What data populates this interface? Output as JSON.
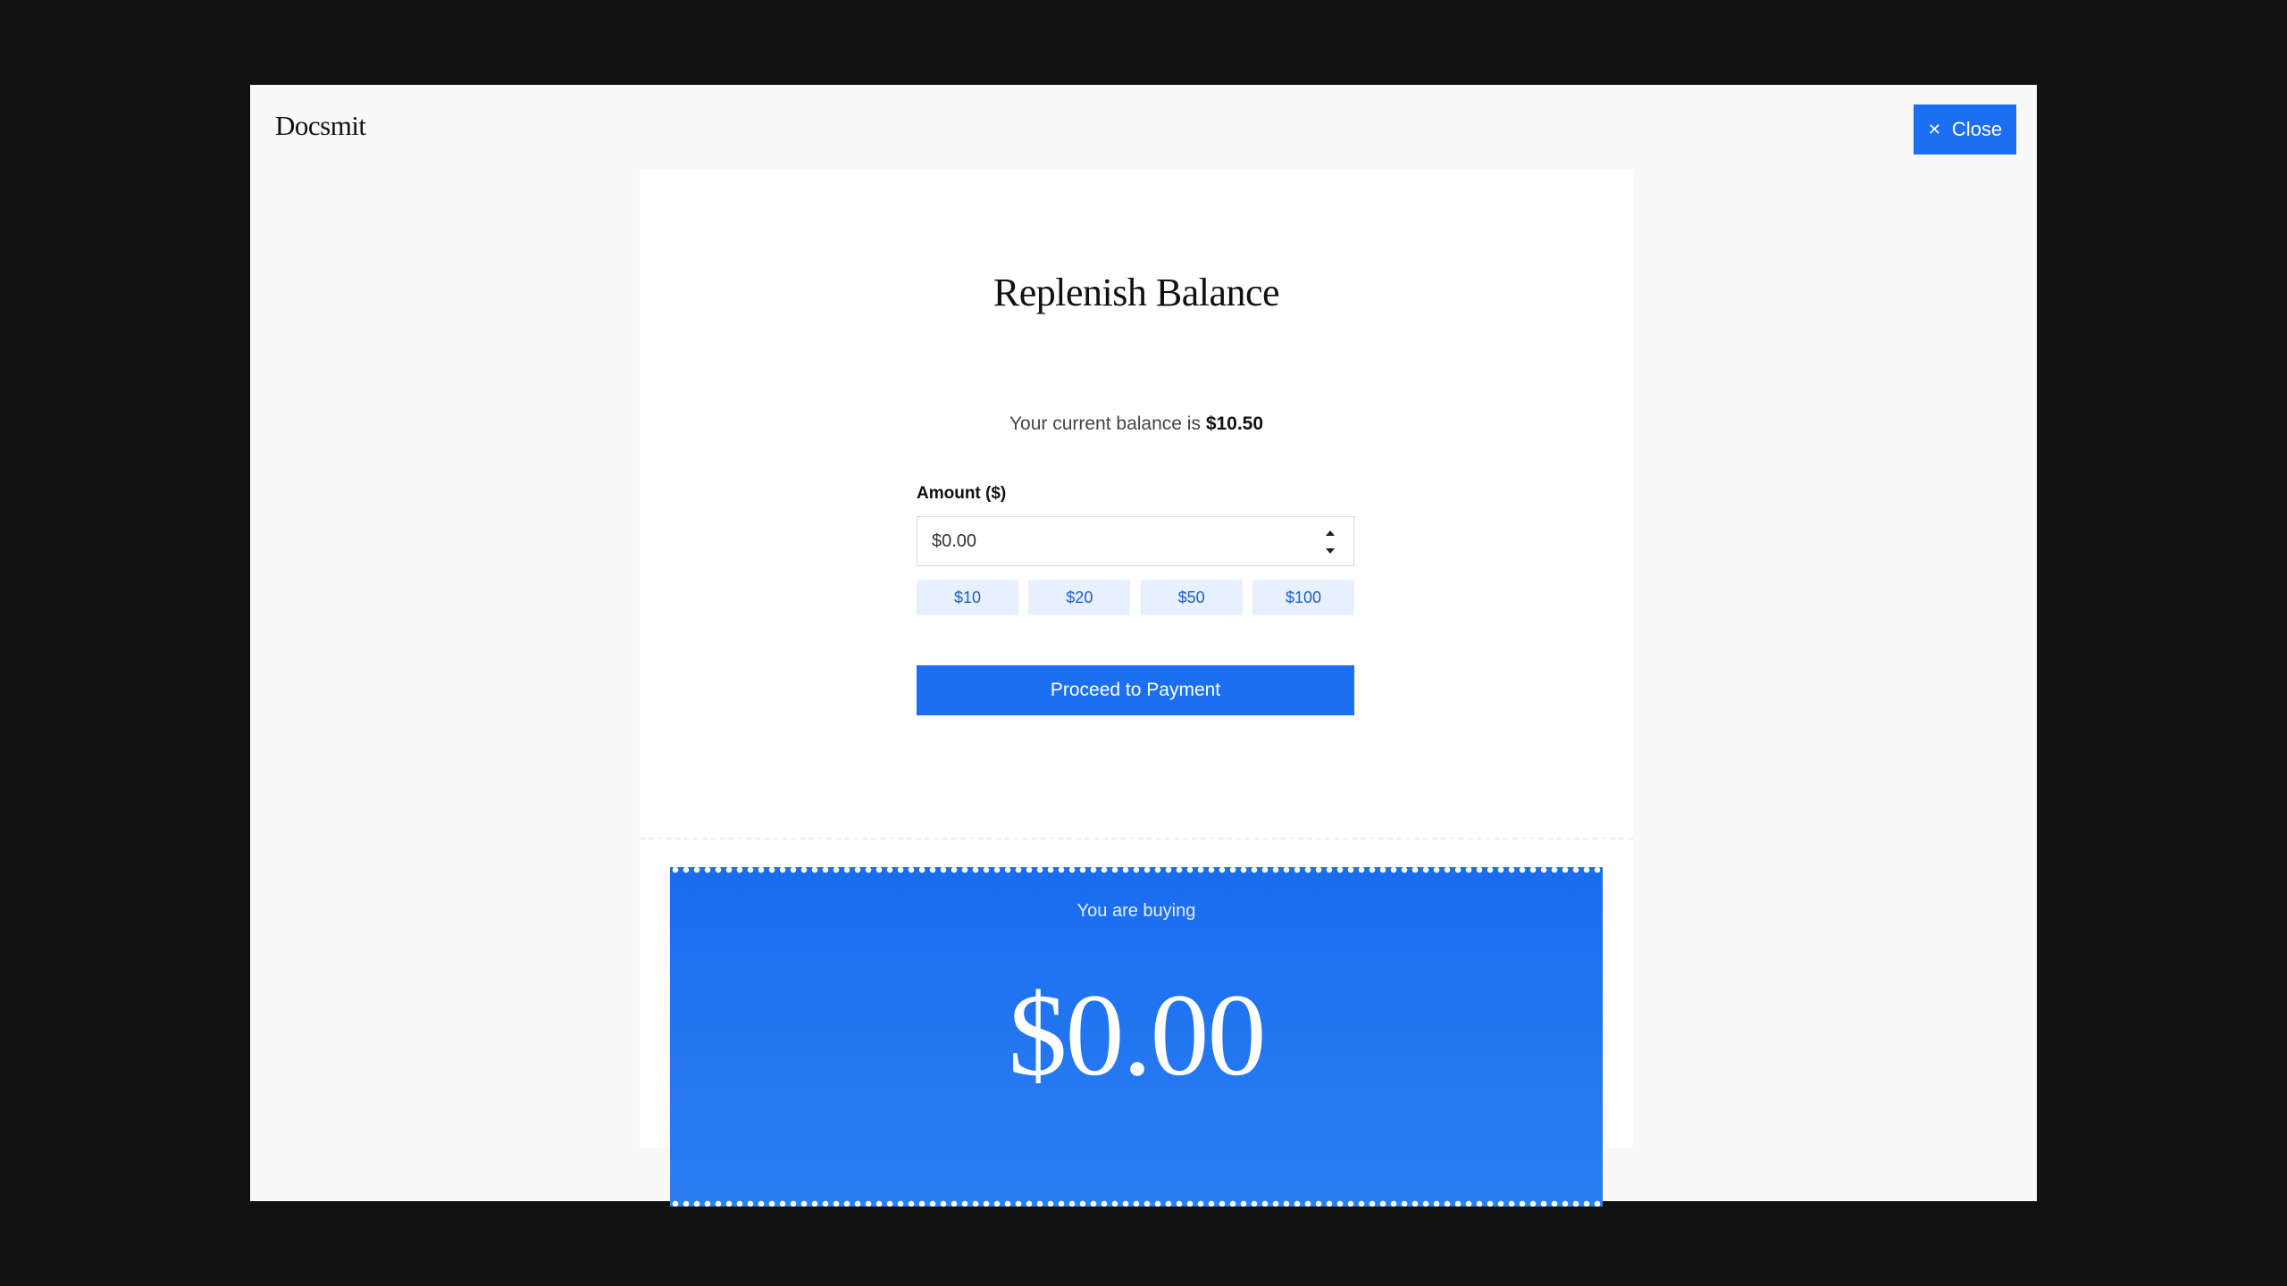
{
  "brand": {
    "name": "Docsmit"
  },
  "header": {
    "close_label": "Close"
  },
  "card": {
    "title": "Replenish Balance",
    "balance_prefix": "Your current balance is",
    "balance_value": "$10.50"
  },
  "form": {
    "amount_label": "Amount ($)",
    "amount_value": "",
    "amount_placeholder": "$0.00",
    "presets": [
      "$10",
      "$20",
      "$50",
      "$100"
    ],
    "proceed_label": "Proceed to Payment"
  },
  "ticket": {
    "label": "You are buying",
    "amount": "$0.00"
  },
  "colors": {
    "accent": "#1c6ff0",
    "preset_bg": "#e8f0fd",
    "preset_text": "#1c5fc9",
    "backdrop": "#111111",
    "modal_bg": "#f9f9f9"
  },
  "icons": {
    "close": "close-icon",
    "stepper_up": "chevron-up-icon",
    "stepper_down": "chevron-down-icon"
  }
}
